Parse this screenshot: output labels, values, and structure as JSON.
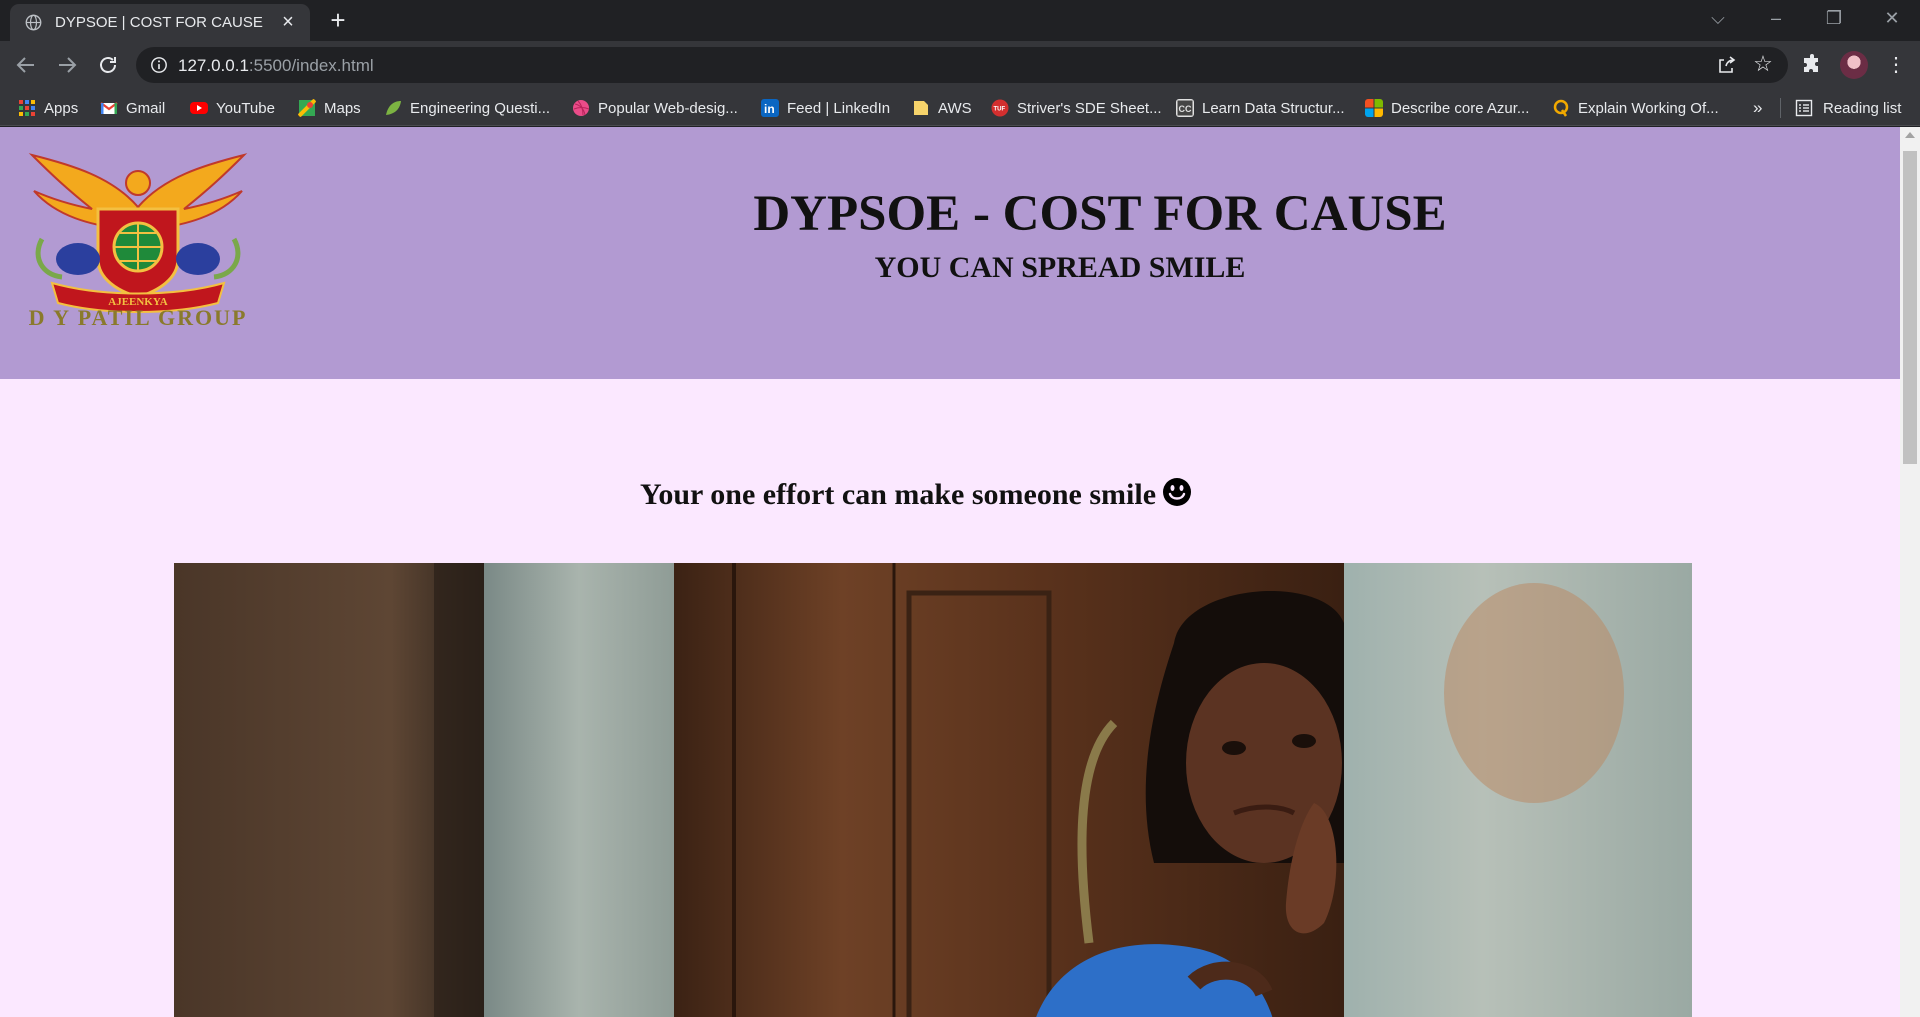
{
  "browser": {
    "tab_title": "DYPSOE | COST FOR CAUSE",
    "url_host": "127.0.0.1",
    "url_path": ":5500/index.html"
  },
  "bookmarks": [
    {
      "label": "Apps",
      "icon": "apps-grid-icon",
      "color": "#4285f4"
    },
    {
      "label": "Gmail",
      "icon": "gmail-icon",
      "color": "#ea4335"
    },
    {
      "label": "YouTube",
      "icon": "youtube-icon",
      "color": "#ff0000"
    },
    {
      "label": "Maps",
      "icon": "maps-icon",
      "color": "#34a853"
    },
    {
      "label": "Engineering Questi...",
      "icon": "leaf-icon",
      "color": "#7cb342"
    },
    {
      "label": "Popular Web-desig...",
      "icon": "dribbble-icon",
      "color": "#ea4c89"
    },
    {
      "label": "Feed | LinkedIn",
      "icon": "linkedin-icon",
      "color": "#0a66c2"
    },
    {
      "label": "AWS",
      "icon": "folder-icon",
      "color": "#f6d36b"
    },
    {
      "label": "Striver's SDE Sheet...",
      "icon": "tuf-icon",
      "color": "#d32f2f"
    },
    {
      "label": "Learn Data Structur...",
      "icon": "cc-icon",
      "color": "#bdbdbd"
    },
    {
      "label": "Describe core Azur...",
      "icon": "microsoft-icon",
      "color": "#f25022"
    },
    {
      "label": "Explain Working Of...",
      "icon": "quora-icon",
      "color": "#f2a900"
    }
  ],
  "bookmarks_more": "»",
  "reading_list": "Reading list",
  "page": {
    "title": "DYPSOE - COST FOR CAUSE",
    "subtitle": "YOU CAN SPREAD SMILE",
    "tagline": "Your one effort can make someone smile",
    "logo_text": "D Y PATIL GROUP",
    "logo_ribbon": "AJEENKYA",
    "header_color": "#b29ad2",
    "body_color": "#fbe8ff"
  }
}
